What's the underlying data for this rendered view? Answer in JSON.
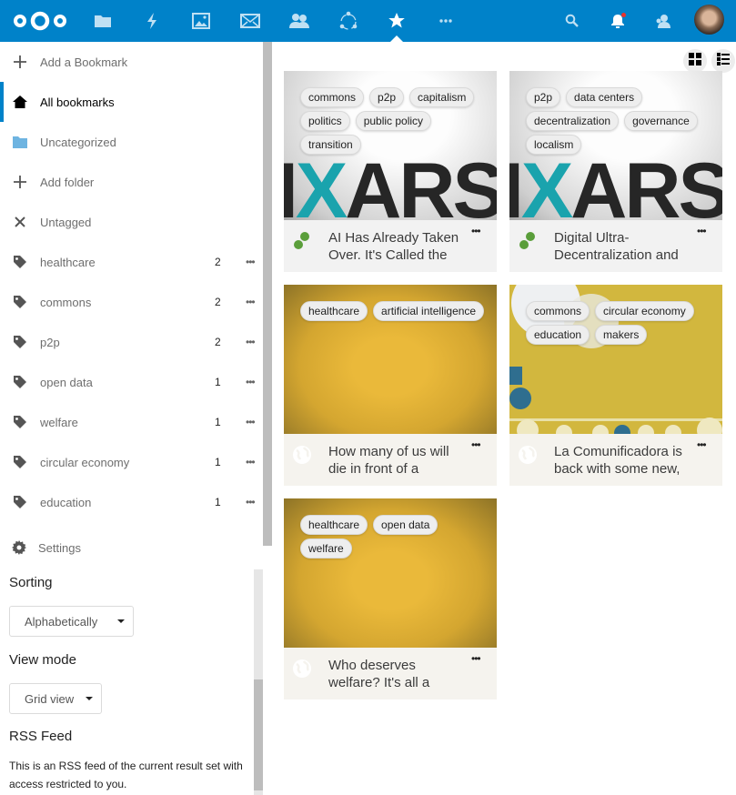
{
  "topbar": {
    "apps": [
      {
        "name": "files",
        "icon": "folder-icon"
      },
      {
        "name": "activity",
        "icon": "lightning-icon"
      },
      {
        "name": "gallery",
        "icon": "image-icon"
      },
      {
        "name": "mail",
        "icon": "mail-icon"
      },
      {
        "name": "contacts",
        "icon": "contacts-icon"
      },
      {
        "name": "circles",
        "icon": "circles-icon"
      },
      {
        "name": "bookmarks",
        "icon": "star-icon",
        "active": true
      },
      {
        "name": "more-apps",
        "icon": "ellipsis-icon"
      }
    ],
    "right": [
      "search-icon",
      "notifications-icon",
      "contacts-menu-icon",
      "avatar"
    ],
    "accent": "#0082c9"
  },
  "sidebar": {
    "add_bookmark": "Add a Bookmark",
    "all_bookmarks": "All bookmarks",
    "uncategorized": "Uncategorized",
    "add_folder": "Add folder",
    "untagged": "Untagged",
    "tags": [
      {
        "label": "healthcare",
        "count": "2"
      },
      {
        "label": "commons",
        "count": "2"
      },
      {
        "label": "p2p",
        "count": "2"
      },
      {
        "label": "open data",
        "count": "1"
      },
      {
        "label": "welfare",
        "count": "1"
      },
      {
        "label": "circular economy",
        "count": "1"
      },
      {
        "label": "education",
        "count": "1"
      }
    ],
    "more_glyph": "•••",
    "settings": {
      "label": "Settings",
      "sorting_title": "Sorting",
      "sorting_value": "Alphabetically",
      "view_mode_title": "View mode",
      "view_mode_value": "Grid view",
      "rss_title": "RSS Feed",
      "rss_text": "This is an RSS feed of the current result set with access restricted to you."
    }
  },
  "main": {
    "view_buttons": [
      "grid-view-icon",
      "list-view-icon"
    ],
    "menu_glyph": "•••",
    "bookmarks": [
      {
        "title": "AI Has Already Taken Over. It's Called the",
        "tags": [
          "commons",
          "p2p",
          "capitalism",
          "politics",
          "public policy",
          "transition"
        ],
        "thumb": "ixars",
        "favicon": "green-dots"
      },
      {
        "title": "Digital Ultra-Decentralization and",
        "tags": [
          "p2p",
          "data centers",
          "decentralization",
          "governance",
          "localism"
        ],
        "thumb": "ixars",
        "favicon": "green-dots"
      },
      {
        "title": "How many of us will die in front of a",
        "tags": [
          "healthcare",
          "artificial intelligence"
        ],
        "thumb": "gold",
        "favicon": "globe"
      },
      {
        "title": "La Comunificadora is back with some new,",
        "tags": [
          "commons",
          "circular economy",
          "education",
          "makers"
        ],
        "thumb": "comuni",
        "favicon": "globe"
      },
      {
        "title": "Who deserves welfare? It's all a",
        "tags": [
          "healthcare",
          "open data",
          "welfare"
        ],
        "thumb": "gold",
        "favicon": "globe"
      }
    ]
  }
}
